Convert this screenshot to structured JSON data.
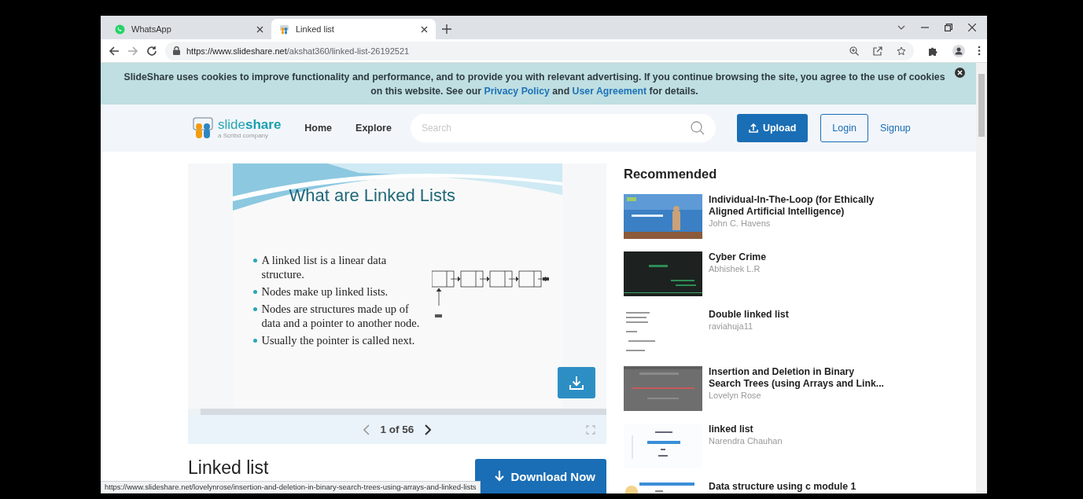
{
  "browser": {
    "tabs": [
      {
        "title": "WhatsApp",
        "kind": "whatsapp",
        "selected": false
      },
      {
        "title": "Linked list",
        "kind": "slideshare",
        "selected": true
      }
    ],
    "url_host": "https://www.slideshare.net",
    "url_path": "/akshat360/linked-list-26192521"
  },
  "cookie_banner": {
    "text_1": "SlideShare uses cookies to improve functionality and performance, and to provide you with relevant advertising. If you continue browsing the site, you agree to the use of cookies on this website. See our",
    "link_1": "Privacy Policy",
    "text_2": "and",
    "link_2": "User Agreement",
    "text_3": "for details."
  },
  "header": {
    "logo": "slide**share**",
    "tagline": "a Scribd company",
    "nav": [
      "Home",
      "Explore"
    ],
    "search": {
      "placeholder": "Search"
    },
    "buttons": [
      {
        "label": "Upload",
        "kind": "primary"
      },
      {
        "label": "Login",
        "kind": "outline"
      },
      {
        "label": "Signup",
        "kind": "link"
      }
    ]
  },
  "slide": {
    "title": "What are Linked Lists",
    "bullets": [
      "A linked list is a linear data structure.",
      "Nodes make up linked lists.",
      "Nodes are structures made up of data and a pointer to another node.",
      "Usually the pointer is called next."
    ],
    "page": "1 of 56",
    "level": 0.03
  },
  "document": {
    "title": "Linked list",
    "download": "Download Now"
  },
  "recommended": {
    "heading": "Recommended",
    "items": [
      {
        "title": "Individual-In-The-Loop (for Ethically Aligned Artificial Intelligence)",
        "author": "John C. Havens"
      },
      {
        "title": "Cyber Crime",
        "author": "Abhishek L.R"
      },
      {
        "title": "Double linked list",
        "author": "raviahuja11"
      },
      {
        "title": "Insertion and Deletion in Binary Search Trees (using Arrays and Link...",
        "author": "Lovelyn Rose"
      },
      {
        "title": "linked list",
        "author": "Narendra Chauhan"
      },
      {
        "title": "Data structure using c module 1"
      }
    ]
  },
  "status_url": "https://www.slideshare.net/lovelynrose/insertion-and-deletion-in-binary-search-trees-using-arrays-and-linked-lists"
}
